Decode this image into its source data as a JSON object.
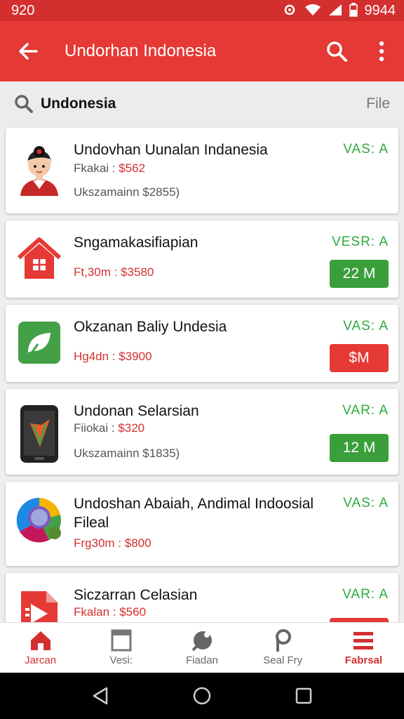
{
  "status_bar": {
    "time": "920",
    "battery_text": "9944"
  },
  "app_bar": {
    "title": "Undorhan Indonesia"
  },
  "search": {
    "query": "Undonesia",
    "filter_label": "File"
  },
  "items": [
    {
      "name": "Undovhan Uunalan Indanesia",
      "line1_label": "Fkakai : ",
      "line1_price": "$562",
      "line2": "Ukszamainn $2855)",
      "version": "VAS: A",
      "icon": "avatar-icon"
    },
    {
      "name": "Sngamakasifiapian",
      "line1_label": "Ft,30m : ",
      "line1_price": "$3580",
      "version": "VESR: A",
      "size": "22 M",
      "size_color": "#3a9e3a",
      "icon": "house-icon"
    },
    {
      "name": "Okzanan Baliy Undesia",
      "line1_label": "Hg4dn : ",
      "line1_price": "$3900",
      "version": "VAS: A",
      "size": "$M",
      "size_color": "#e53935",
      "icon": "leaf-chat-icon"
    },
    {
      "name": "Undonan Selarsian",
      "line1_label": "Fiiokai : ",
      "line1_price": "$320",
      "line2": "Ukszamainn $1835)",
      "version": "VAR: A",
      "size": "12 M",
      "size_color": "#3a9e3a",
      "icon": "phone-icon"
    },
    {
      "name": "Undoshan Abaiah, Andimal Indoosial Fileal",
      "line1_label": "Frg30m : ",
      "line1_price": "$800",
      "version": "VAS: A",
      "icon": "colorful-circle-icon"
    },
    {
      "name": "Siczarran Celasian",
      "line1_label": "Fkalan : ",
      "line1_price": "$560",
      "version": "VAR: A",
      "icon": "play-file-icon"
    }
  ],
  "bottom_nav": [
    {
      "label": "Jarcan",
      "icon": "home-icon",
      "active": true
    },
    {
      "label": "Vesi:",
      "icon": "folder-icon",
      "active": false
    },
    {
      "label": "Fiadan",
      "icon": "pin-icon",
      "active": false
    },
    {
      "label": "Seal Fry",
      "icon": "p-icon",
      "active": false
    },
    {
      "label": "Fabrsal",
      "icon": "menu-icon",
      "active": true
    }
  ],
  "colors": {
    "primary": "#e53935",
    "status": "#d32f2f",
    "accent_green": "#2eaa3f"
  }
}
